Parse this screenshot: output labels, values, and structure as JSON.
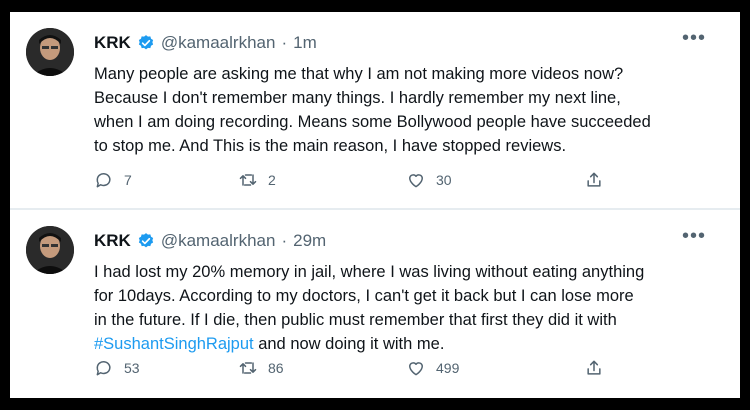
{
  "tweets": [
    {
      "author": "KRK",
      "handle": "@kamaalrkhan",
      "separator": "·",
      "time": "1m",
      "lines": [
        "Many people are asking me that why I am not making more videos now?",
        "Because I don't remember many things. I hardly remember my next line,",
        "when I am doing recording. Means some Bollywood people have succeeded",
        "to stop me. And This is the main reason, I have stopped reviews."
      ],
      "replies": "7",
      "retweets": "2",
      "likes": "30"
    },
    {
      "author": "KRK",
      "handle": "@kamaalrkhan",
      "separator": "·",
      "time": "29m",
      "lines": [
        "I had lost my 20% memory in jail, where I was living without eating anything",
        "for 10days. According to my doctors, I can't get it back but I can lose more",
        "in the future. If I die, then public must remember that first they did it with"
      ],
      "hashtag": "#SushantSinghRajput",
      "last_line_rest": " and now doing it with me.",
      "replies": "53",
      "retweets": "86",
      "likes": "499"
    }
  ],
  "colors": {
    "accent": "#1d9bf0",
    "muted_text": "#536471",
    "body_text": "#0f1419"
  },
  "icons": {
    "more": "more-options-icon",
    "verified": "verified-badge-icon",
    "reply": "reply-icon",
    "retweet": "retweet-icon",
    "like": "heart-icon",
    "share": "share-icon"
  }
}
